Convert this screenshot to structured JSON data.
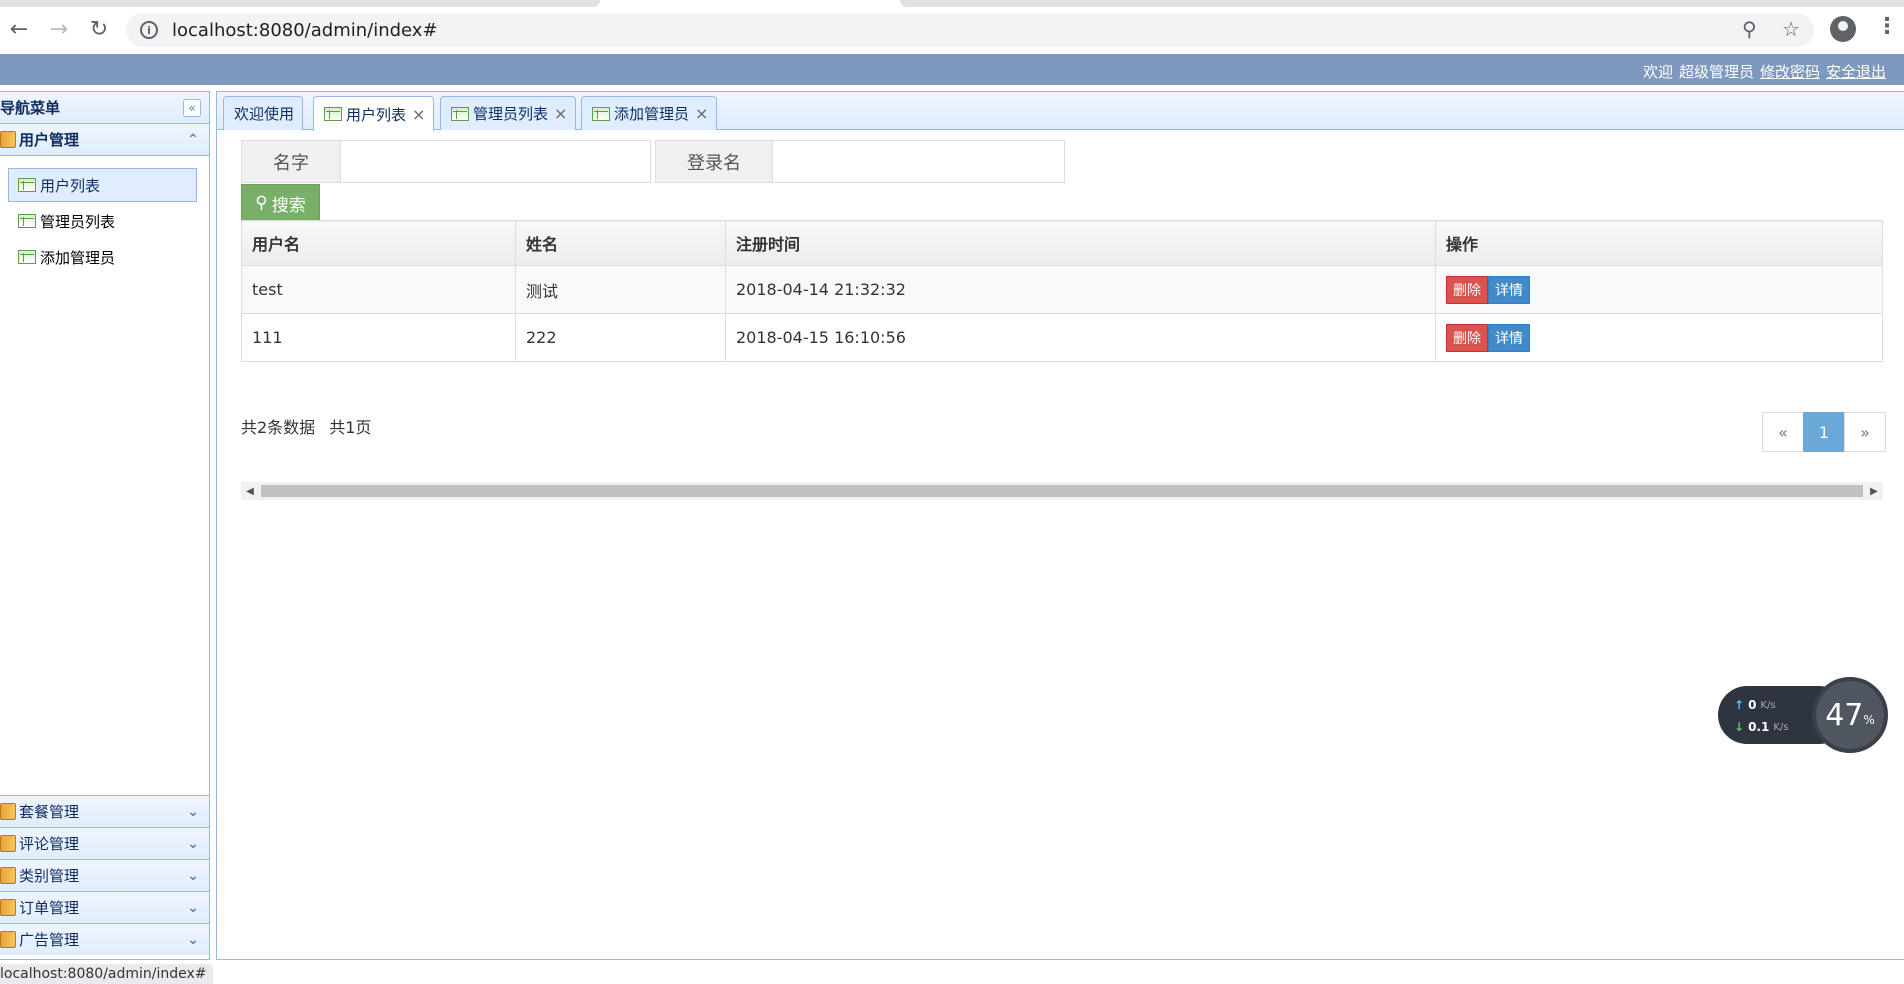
{
  "browser": {
    "url": "localhost:8080/admin/index#",
    "status_url": "localhost:8080/admin/index#"
  },
  "header": {
    "welcome": "欢迎",
    "role": "超级管理员",
    "change_password": "修改密码",
    "logout": "安全退出"
  },
  "sidebar": {
    "title": "导航菜单",
    "groups": [
      {
        "label": "用户管理",
        "expanded": true,
        "items": [
          {
            "label": "用户列表",
            "active": true
          },
          {
            "label": "管理员列表"
          },
          {
            "label": "添加管理员"
          }
        ]
      },
      {
        "label": "套餐管理"
      },
      {
        "label": "评论管理"
      },
      {
        "label": "类别管理"
      },
      {
        "label": "订单管理"
      },
      {
        "label": "广告管理"
      }
    ]
  },
  "tabs": [
    {
      "label": "欢迎使用",
      "closable": false
    },
    {
      "label": "用户列表",
      "closable": true,
      "active": true
    },
    {
      "label": "管理员列表",
      "closable": true
    },
    {
      "label": "添加管理员",
      "closable": true
    }
  ],
  "search": {
    "name_label": "名字",
    "name_value": "",
    "login_label": "登录名",
    "login_value": "",
    "button_label": "搜索"
  },
  "table": {
    "columns": [
      "用户名",
      "姓名",
      "注册时间",
      "操作"
    ],
    "rows": [
      {
        "username": "test",
        "name": "测试",
        "registered": "2018-04-14 21:32:32"
      },
      {
        "username": "111",
        "name": "222",
        "registered": "2018-04-15 16:10:56"
      }
    ],
    "delete_label": "删除",
    "detail_label": "详情"
  },
  "pager": {
    "total_records": "共2条数据",
    "total_pages": "共1页",
    "prev": "«",
    "current": "1",
    "next": "»"
  },
  "net_widget": {
    "up_speed": "0",
    "down_speed": "0.1",
    "unit": "K/s",
    "percent": "47",
    "percent_sign": "%"
  }
}
